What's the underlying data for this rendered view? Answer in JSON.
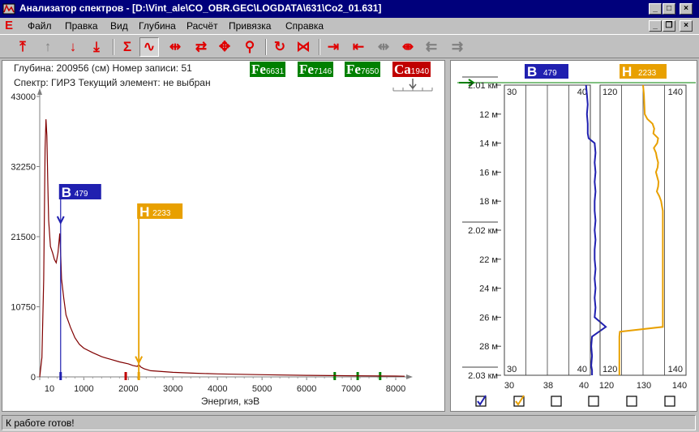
{
  "window": {
    "title": "Анализатор спектров - [D:\\Vint_ale\\CO_OBR.GEC\\LOGDATA\\631\\Co2_01.631]",
    "app_icon": "analyzer-icon",
    "controls": [
      "minimize-icon",
      "maximize-icon",
      "close-icon"
    ]
  },
  "menu": {
    "app_letter": "E",
    "items": [
      "Файл",
      "Правка",
      "Вид",
      "Глубина",
      "Расчёт",
      "Привязка",
      "Справка"
    ]
  },
  "toolbar": {
    "buttons": [
      {
        "name": "move-top-icon",
        "glyph": "⤒",
        "color": "red"
      },
      {
        "name": "move-up-icon",
        "glyph": "↑",
        "color": "gray"
      },
      {
        "name": "move-down-icon",
        "glyph": "↓",
        "color": "red"
      },
      {
        "name": "move-bottom-icon",
        "glyph": "⤓",
        "color": "red"
      },
      {
        "name": "sum-icon",
        "glyph": "Σ",
        "color": "red"
      },
      {
        "name": "spectrum-icon",
        "glyph": "∿",
        "color": "red",
        "pressed": true
      },
      {
        "name": "fit-width-icon",
        "glyph": "⇹",
        "color": "red"
      },
      {
        "name": "cycle-icon",
        "glyph": "⇄",
        "color": "red"
      },
      {
        "name": "move-all-icon",
        "glyph": "✥",
        "color": "red"
      },
      {
        "name": "zoom-icon",
        "glyph": "⚲",
        "color": "red"
      },
      {
        "name": "refresh-icon",
        "glyph": "↻",
        "color": "red"
      },
      {
        "name": "collapse-icon",
        "glyph": "⋈",
        "color": "red"
      },
      {
        "name": "shift-right-plus-icon",
        "glyph": "⇥",
        "color": "red"
      },
      {
        "name": "shift-left-minus-icon",
        "glyph": "⇤",
        "color": "red"
      },
      {
        "name": "shift-both-icon",
        "glyph": "⇹",
        "color": "gray"
      },
      {
        "name": "shift-both-red-icon",
        "glyph": "⇼",
        "color": "red"
      },
      {
        "name": "arrow-left-gray-icon",
        "glyph": "⇇",
        "color": "gray"
      },
      {
        "name": "arrow-right-gray-icon",
        "glyph": "⇉",
        "color": "gray"
      }
    ]
  },
  "info": {
    "depth_line": "Глубина: 200956 (см)  Номер записи: 51",
    "spectrum_line": "Спектр: ГИРЗ  Текущий элемент: не выбран"
  },
  "badges": [
    {
      "symbol": "Fe",
      "value": "6631",
      "color": "#008000"
    },
    {
      "symbol": "Fe",
      "value": "7146",
      "color": "#008000"
    },
    {
      "symbol": "Fe",
      "value": "7650",
      "color": "#008000"
    },
    {
      "symbol": "Ca",
      "value": "1940",
      "color": "#c00000"
    }
  ],
  "colors": {
    "curve": "#800000",
    "boron": "#2020b0",
    "hydrogen": "#e8a000",
    "green": "#008000",
    "red": "#c00000"
  },
  "chart_data": {
    "type": "line",
    "xlabel": "Энергия, кэВ",
    "ylabel": "",
    "xlim": [
      10,
      8200
    ],
    "ylim": [
      0,
      43000
    ],
    "x_ticks": [
      "10",
      "1000",
      "2000",
      "3000",
      "4000",
      "5000",
      "6000",
      "7000",
      "8000"
    ],
    "y_ticks": [
      "0",
      "10750",
      "21500",
      "32250",
      "43000"
    ],
    "series": [
      {
        "x": [
          10,
          60,
          100,
          130,
          150,
          170,
          190,
          210,
          250,
          300,
          340,
          380,
          420,
          440,
          460,
          480,
          500,
          550,
          600,
          700,
          800,
          900,
          1000,
          1200,
          1400,
          1600,
          1800,
          2000,
          2100,
          2200,
          2233,
          2280,
          2350,
          2500,
          3000,
          3500,
          4000,
          5000,
          6000,
          7000,
          8000,
          8200
        ],
        "y": [
          0,
          3000,
          15000,
          35000,
          39500,
          37000,
          30000,
          24000,
          20000,
          19000,
          18000,
          17500,
          19000,
          20500,
          22000,
          19000,
          15000,
          12000,
          9500,
          7600,
          6000,
          5000,
          4400,
          3700,
          3100,
          2700,
          2300,
          2000,
          1750,
          1600,
          1900,
          1500,
          1250,
          950,
          700,
          560,
          460,
          330,
          240,
          170,
          130,
          100
        ]
      }
    ],
    "markers": [
      {
        "symbol": "B",
        "value": "479",
        "x": 479,
        "color": "#2020b0"
      },
      {
        "symbol": "H",
        "value": "2233",
        "x": 2233,
        "color": "#e8a000"
      }
    ],
    "ticks_bottom": [
      {
        "x": 479,
        "color": "#2020b0"
      },
      {
        "x": 1940,
        "color": "#c00000"
      },
      {
        "x": 2233,
        "color": "#e8a000"
      },
      {
        "x": 6631,
        "color": "#008000"
      },
      {
        "x": 7146,
        "color": "#008000"
      },
      {
        "x": 7650,
        "color": "#008000"
      }
    ]
  },
  "depth_panel": {
    "arrow_icon": "depth-arrow-icon",
    "labels": [
      "2.01 км",
      "12 м",
      "14 м",
      "16 м",
      "18 м",
      "2.02 км",
      "22 м",
      "24 м",
      "26 м",
      "28 м",
      "2.03 км"
    ],
    "tracks": [
      {
        "symbol": "B",
        "value": "479",
        "color": "#2020b0",
        "top_left": "30",
        "top_right": "40",
        "bottom_left": "30",
        "bottom_right": "40",
        "axis_labels": [
          "30",
          "38",
          "40"
        ],
        "xlim": [
          30,
          40
        ],
        "depths": [
          0,
          1,
          2,
          3,
          4,
          5,
          5.5,
          6,
          7,
          8,
          9,
          10,
          11,
          12,
          13,
          14,
          15,
          16,
          17,
          18,
          19,
          20,
          21,
          22,
          23,
          24,
          25,
          26,
          27,
          28,
          29,
          29.5,
          30
        ],
        "values": [
          39.5,
          39.6,
          39.7,
          39.6,
          39.7,
          39.7,
          39.8,
          40.5,
          40.6,
          40.5,
          40.6,
          40.5,
          40.6,
          40.5,
          40.5,
          40.6,
          40.5,
          40.6,
          40.5,
          40.5,
          40.6,
          40.5,
          40.6,
          40.5,
          40.6,
          40.5,
          41.8,
          40.2,
          40.1,
          40.2,
          40.1,
          40.2,
          40.2
        ]
      },
      {
        "symbol": "H",
        "value": "2233",
        "color": "#e8a000",
        "top_left": "120",
        "top_right": "140",
        "bottom_left": "120",
        "bottom_right": "140",
        "axis_labels": [
          "120",
          "130",
          "140"
        ],
        "xlim": [
          120,
          140
        ],
        "depths": [
          0,
          1,
          2,
          3,
          3.5,
          4,
          4.5,
          5,
          5.5,
          6,
          6.5,
          7,
          7.5,
          8,
          8.5,
          9,
          9.5,
          10,
          10.5,
          11,
          11.5,
          12,
          12.5,
          13,
          15,
          17,
          20,
          22,
          24,
          25,
          25.5,
          26,
          28,
          30
        ],
        "values": [
          130,
          130.2,
          130.3,
          130.4,
          131,
          132.2,
          132.6,
          132.4,
          133.5,
          133.3,
          132.5,
          133,
          133.2,
          133.5,
          133.4,
          133,
          133.3,
          133.6,
          133.5,
          133.2,
          133.8,
          134.2,
          134.4,
          134.6,
          134.6,
          134.6,
          134.6,
          134.6,
          134.6,
          134.6,
          124.6,
          124.5,
          124.5,
          124.5
        ]
      }
    ],
    "checkboxes": [
      true,
      true,
      false,
      false,
      false,
      false
    ]
  },
  "status": {
    "text": "К работе готов!"
  }
}
